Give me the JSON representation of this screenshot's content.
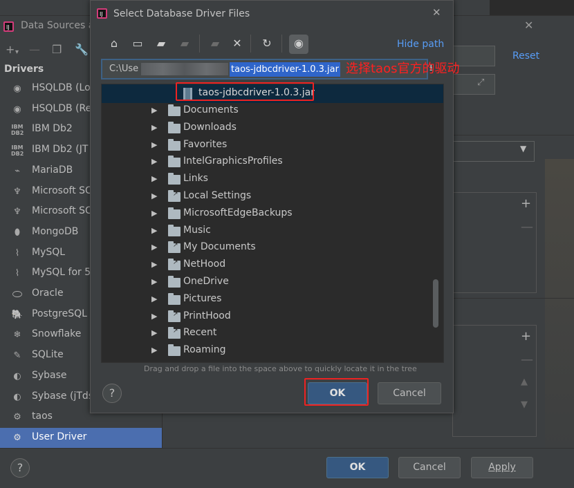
{
  "background_window": {
    "title": "Data Sources a",
    "reset_label": "Reset",
    "drivers_title": "Drivers",
    "drivers": [
      {
        "label": "HSQLDB (Loc",
        "icon": "hsqldb-icon"
      },
      {
        "label": "HSQLDB (Re",
        "icon": "hsqldb-icon"
      },
      {
        "label": "IBM Db2",
        "icon": "ibm-db2-icon"
      },
      {
        "label": "IBM Db2 (JT",
        "icon": "ibm-db2-icon"
      },
      {
        "label": "MariaDB",
        "icon": "mariadb-icon"
      },
      {
        "label": "Microsoft SC",
        "icon": "mssql-icon"
      },
      {
        "label": "Microsoft SC",
        "icon": "mssql-icon"
      },
      {
        "label": "MongoDB",
        "icon": "mongodb-icon"
      },
      {
        "label": "MySQL",
        "icon": "mysql-icon"
      },
      {
        "label": "MySQL for 5.",
        "icon": "mysql-icon"
      },
      {
        "label": "Oracle",
        "icon": "oracle-icon"
      },
      {
        "label": "PostgreSQL",
        "icon": "postgresql-icon"
      },
      {
        "label": "Snowflake",
        "icon": "snowflake-icon"
      },
      {
        "label": "SQLite",
        "icon": "sqlite-icon"
      },
      {
        "label": "Sybase",
        "icon": "sybase-icon"
      },
      {
        "label": "Sybase (jTds)",
        "icon": "sybase-icon"
      },
      {
        "label": "taos",
        "icon": "generic-driver-icon"
      },
      {
        "label": "User Driver",
        "icon": "generic-driver-icon",
        "selected": true
      }
    ],
    "buttons": {
      "ok": "OK",
      "cancel": "Cancel",
      "apply": "Apply"
    }
  },
  "dialog": {
    "title": "Select Database Driver Files",
    "hide_path_label": "Hide path",
    "path_prefix": "C:\\Use",
    "path_selected": "taos-jdbcdriver-1.0.3.jar",
    "annotation": "选择taos官方的驱动",
    "selected_file": "taos-jdbcdriver-1.0.3.jar",
    "folders": [
      {
        "label": "Documents",
        "link": false
      },
      {
        "label": "Downloads",
        "link": false
      },
      {
        "label": "Favorites",
        "link": false
      },
      {
        "label": "IntelGraphicsProfiles",
        "link": false
      },
      {
        "label": "Links",
        "link": false
      },
      {
        "label": "Local Settings",
        "link": true
      },
      {
        "label": "MicrosoftEdgeBackups",
        "link": false
      },
      {
        "label": "Music",
        "link": false
      },
      {
        "label": "My Documents",
        "link": true
      },
      {
        "label": "NetHood",
        "link": true
      },
      {
        "label": "OneDrive",
        "link": false
      },
      {
        "label": "Pictures",
        "link": false
      },
      {
        "label": "PrintHood",
        "link": true
      },
      {
        "label": "Recent",
        "link": true
      },
      {
        "label": "Roaming",
        "link": false
      }
    ],
    "hint": "Drag and drop a file into the space above to quickly locate it in the tree",
    "ok_label": "OK",
    "cancel_label": "Cancel"
  },
  "colors": {
    "accent": "#589df6",
    "selection": "#4b6eaf",
    "highlight_box": "#ee2222",
    "annotation": "#ff2020"
  }
}
